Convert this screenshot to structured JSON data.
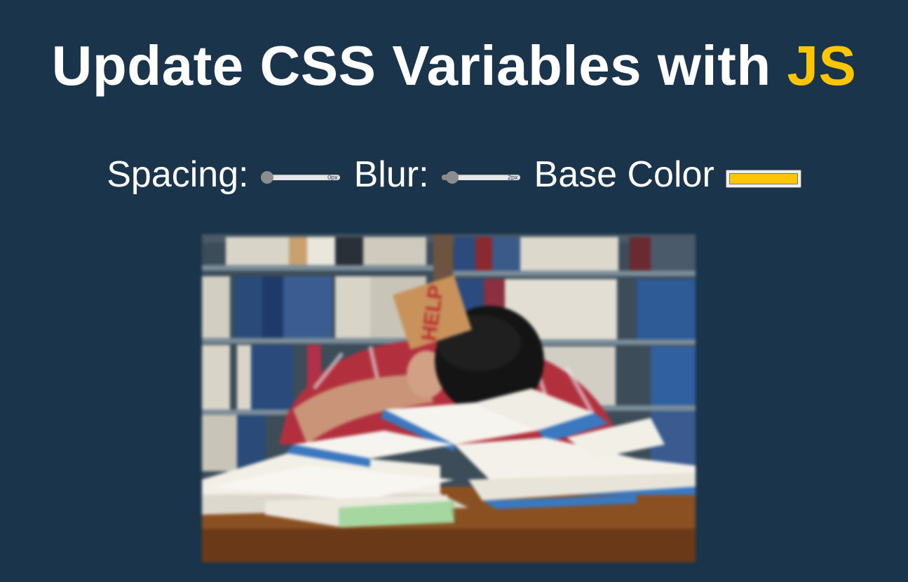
{
  "header": {
    "title_prefix": "Update CSS Variables with",
    "title_highlight": "JS"
  },
  "controls": {
    "spacing": {
      "label": "Spacing:",
      "value": "0px",
      "level": 0
    },
    "blur": {
      "label": "Blur:",
      "value": "2px",
      "level": 0.08
    },
    "base_color": {
      "label": "Base Color",
      "value": "#ffc600"
    }
  },
  "colors": {
    "background": "#1a344b",
    "accent": "#ffc600"
  },
  "image": {
    "sign_text": "HELP"
  }
}
